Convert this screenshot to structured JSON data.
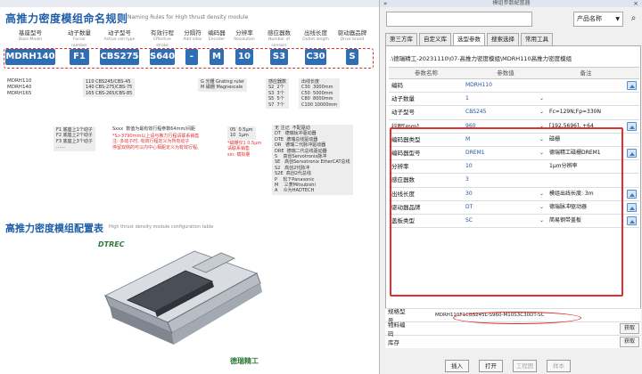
{
  "doc": {
    "title": "高推力密度模组命名规则",
    "subtitle": "Naming Rules for High thrust density module",
    "segments": [
      "MDRH140",
      "F1",
      "CBS275",
      "S640",
      "-",
      "M",
      "10",
      "S3",
      "C30",
      "S"
    ],
    "captions": [
      {
        "cn": "基座型号",
        "en": "Base Model"
      },
      {
        "cn": "动子数量",
        "en": "Forcer number"
      },
      {
        "cn": "动子型号",
        "en": "Active cell type"
      },
      {
        "cn": "有效行程",
        "en": "Effective stroke"
      },
      {
        "cn": "分隔符",
        "en": "Add ndex"
      },
      {
        "cn": "编码器",
        "en": "Encoder"
      },
      {
        "cn": "分辨率",
        "en": "Resolution"
      },
      {
        "cn": "感应器数",
        "en": "Number of sensors"
      },
      {
        "cn": "出线长度",
        "en": "Outlet length"
      },
      {
        "cn": "驱动器品牌",
        "en": "Drive brand"
      }
    ],
    "base_models": "MDRH110\nMDRH140\nMDRH165",
    "cell_types": "110 CBS245/CBS-45\n140 CBS-275/CBS-75\n165 CBS-265/CBS-85",
    "encoder_opts": "G 光栅 Grating ruler\nM 磁栅 Magnescale",
    "sensor_opts": "感应器数\nS2  2个\nS3  3个\nS5  5个\nS7  7个",
    "outlet_opts": "出线长度\nC30  3000mm\nC50  5000mm\nC80  8000mm\nC100 10000mm",
    "forcer_opts": "F1 底座上1个动子\nF2 底座上2个动子\nF3 底座上3个动子\n……",
    "stroke_note": "Sxxx  数值为最有效行程参数64mm/间距",
    "stroke_red": "*S>3790mm以上请与推力行程请联系销售\n注: 多动子时, 有效行程定义为所有动子\n停留双侧的可以内中心相距定义为有效行程。",
    "res_opts": "05  0.5μm\n10  1μm",
    "res_red": "*磁栅仅1 0.5μm\n请联系销售\nsin: 模拟量",
    "drive_opts": "无 注记  不配驱动\nDT   德瑞钛冲驱动器\nDTE  德瑞总线驱动器\nDR   德瑞二代脉冲驱动器\nDRE  德瑞二代总线驱动器\nS    高创Servotronix脉冲\nSE   高创Servotronix EtherCAT总线\nS2   高创2代脉冲\nS2E  高创2代总线\nP    松下Panasonic\nM    三菱Mitsubishi\nA    众为HADTECH",
    "title2": "高推力密度模组配置表",
    "subtitle2": "High thrust density module configuration table",
    "logo": "DTREC",
    "brand": "德瑞精工"
  },
  "panel": {
    "window_title": "模组参数配置器",
    "search": {
      "value": "",
      "category": "产品名称"
    },
    "tabs": [
      "第三方库",
      "自定义库",
      "选型参数",
      "搜索选择",
      "常用工具"
    ],
    "active_tab": 2,
    "path": ".\\德瑞精工-20231110\\07-高推力密度模组\\MDRH110高推力密度模组",
    "columns": [
      "参数名称",
      "参数值",
      "备注"
    ],
    "rows": [
      {
        "name": "编码",
        "value": "MDRH110",
        "note": "",
        "dropdown": false,
        "icon": true
      },
      {
        "name": "动子数量",
        "value": "1",
        "note": "",
        "dropdown": true,
        "icon": false
      },
      {
        "name": "动子型号",
        "value": "CBS245",
        "note": "Fc=129N;Fp=330N",
        "dropdown": true,
        "icon": false
      },
      {
        "name": "行程[mm]",
        "value": "960",
        "note": "[192,5696], +64",
        "dropdown": true,
        "icon": true
      },
      {
        "name": "编码器类型",
        "value": "M",
        "note": "磁栅",
        "dropdown": true,
        "icon": false
      },
      {
        "name": "编码器型号",
        "value": "DREM1",
        "note": "德瑞精工磁栅DREM1",
        "dropdown": true,
        "icon": true
      },
      {
        "name": "分辨率",
        "value": "10",
        "note": "1μm分辨率",
        "dropdown": false,
        "icon": false
      },
      {
        "name": "感应器数",
        "value": "3",
        "note": "",
        "dropdown": false,
        "icon": false
      },
      {
        "name": "出线长度",
        "value": "30",
        "note": "模组出线长度: 3m",
        "dropdown": true,
        "icon": true
      },
      {
        "name": "驱动器品牌",
        "value": "DT",
        "note": "德瑞脉冲驱动器",
        "dropdown": true,
        "icon": true
      },
      {
        "name": "盖板类型",
        "value": "SC",
        "note": "简易钢带盖板",
        "dropdown": true,
        "icon": true
      }
    ],
    "spec": [
      {
        "label": "规格型号",
        "value": "MDRH110F1CBS245L-S960-M10S3C30DT-SC",
        "button": ""
      },
      {
        "label": "物料编码",
        "value": "",
        "button": "获取"
      },
      {
        "label": "库存",
        "value": "",
        "button": "获取"
      }
    ],
    "buttons": [
      {
        "label": "插入",
        "enabled": true
      },
      {
        "label": "打开",
        "enabled": true
      },
      {
        "label": "工程图",
        "enabled": false
      },
      {
        "label": "样本",
        "enabled": false
      }
    ],
    "accent": "#e03030"
  }
}
